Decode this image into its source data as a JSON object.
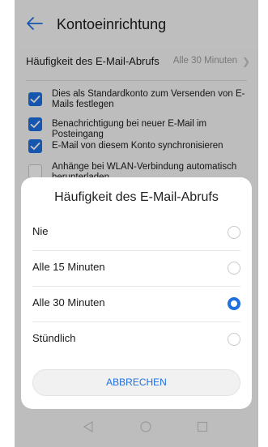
{
  "header": {
    "title": "Kontoeinrichtung"
  },
  "fetch_frequency": {
    "label": "Häufigkeit des E-Mail-Abrufs",
    "value": "Alle 30 Minuten"
  },
  "options": [
    {
      "text": "Dies als Standardkonto zum Versenden von E-Mails festlegen",
      "checked": true
    },
    {
      "text": "Benachrichtigung bei neuer E-Mail im Posteingang",
      "checked": true
    },
    {
      "text": "E-Mail von diesem Konto synchronisieren",
      "checked": true
    },
    {
      "text": "Anhänge bei WLAN-Verbindung automatisch herunterladen",
      "checked": false
    }
  ],
  "dialog": {
    "title": "Häufigkeit des E-Mail-Abrufs",
    "choices": [
      {
        "label": "Nie",
        "selected": false
      },
      {
        "label": "Alle 15 Minuten",
        "selected": false
      },
      {
        "label": "Alle 30 Minuten",
        "selected": true
      },
      {
        "label": "Stündlich",
        "selected": false
      }
    ],
    "cancel_label": "ABBRECHEN"
  },
  "colors": {
    "accent": "#1e6fe0"
  },
  "icons": {
    "back": "arrow-left-icon",
    "nav": [
      "back-triangle-icon",
      "home-circle-icon",
      "recents-square-icon"
    ]
  }
}
